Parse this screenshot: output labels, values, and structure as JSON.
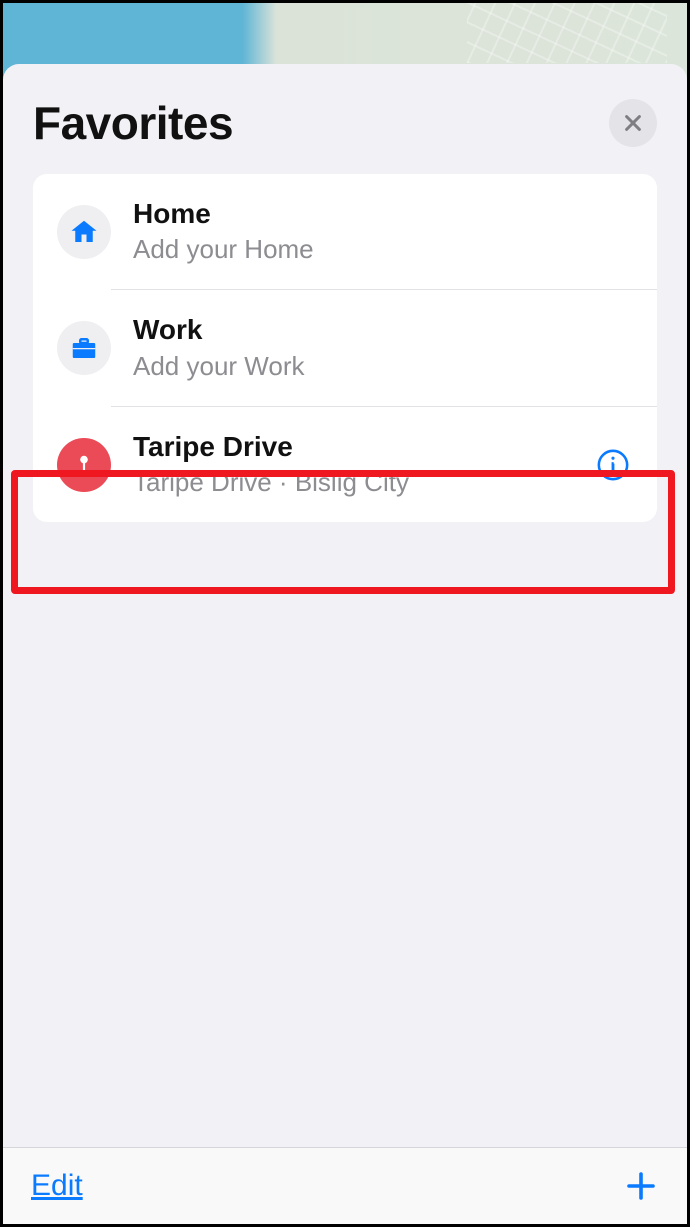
{
  "header": {
    "title": "Favorites"
  },
  "favorites": [
    {
      "title": "Home",
      "subtitle": "Add your Home",
      "icon": "home-icon",
      "icon_bg": "grey",
      "has_info": false
    },
    {
      "title": "Work",
      "subtitle": "Add your Work",
      "icon": "briefcase-icon",
      "icon_bg": "grey",
      "has_info": false
    },
    {
      "title": "Taripe Drive",
      "subtitle": "Taripe Drive · Bislig City",
      "icon": "pin-icon",
      "icon_bg": "red",
      "has_info": true
    }
  ],
  "toolbar": {
    "edit_label": "Edit"
  },
  "annotation": {
    "highlight_index": 2
  }
}
